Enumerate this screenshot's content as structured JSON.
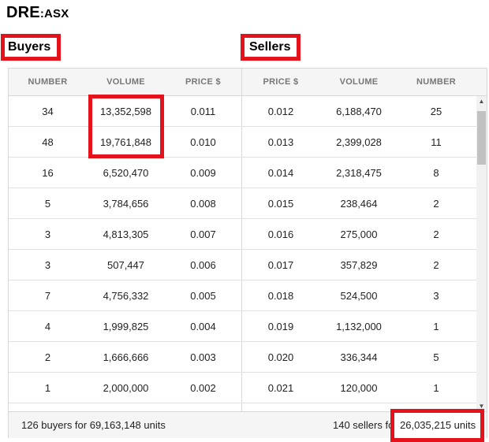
{
  "ticker": {
    "code": "DRE",
    "exchange": ":ASX"
  },
  "labels": {
    "buyers": "Buyers",
    "sellers": "Sellers"
  },
  "headers": {
    "buyer_number": "NUMBER",
    "buyer_volume": "VOLUME",
    "buyer_price": "PRICE $",
    "seller_price": "PRICE $",
    "seller_volume": "VOLUME",
    "seller_number": "NUMBER"
  },
  "rows": [
    {
      "buyer_number": "34",
      "buyer_volume": "13,352,598",
      "buyer_price": "0.011",
      "seller_price": "0.012",
      "seller_volume": "6,188,470",
      "seller_number": "25"
    },
    {
      "buyer_number": "48",
      "buyer_volume": "19,761,848",
      "buyer_price": "0.010",
      "seller_price": "0.013",
      "seller_volume": "2,399,028",
      "seller_number": "11"
    },
    {
      "buyer_number": "16",
      "buyer_volume": "6,520,470",
      "buyer_price": "0.009",
      "seller_price": "0.014",
      "seller_volume": "2,318,475",
      "seller_number": "8"
    },
    {
      "buyer_number": "5",
      "buyer_volume": "3,784,656",
      "buyer_price": "0.008",
      "seller_price": "0.015",
      "seller_volume": "238,464",
      "seller_number": "2"
    },
    {
      "buyer_number": "3",
      "buyer_volume": "4,813,305",
      "buyer_price": "0.007",
      "seller_price": "0.016",
      "seller_volume": "275,000",
      "seller_number": "2"
    },
    {
      "buyer_number": "3",
      "buyer_volume": "507,447",
      "buyer_price": "0.006",
      "seller_price": "0.017",
      "seller_volume": "357,829",
      "seller_number": "2"
    },
    {
      "buyer_number": "7",
      "buyer_volume": "4,756,332",
      "buyer_price": "0.005",
      "seller_price": "0.018",
      "seller_volume": "524,500",
      "seller_number": "3"
    },
    {
      "buyer_number": "4",
      "buyer_volume": "1,999,825",
      "buyer_price": "0.004",
      "seller_price": "0.019",
      "seller_volume": "1,132,000",
      "seller_number": "1"
    },
    {
      "buyer_number": "2",
      "buyer_volume": "1,666,666",
      "buyer_price": "0.003",
      "seller_price": "0.020",
      "seller_volume": "336,344",
      "seller_number": "5"
    },
    {
      "buyer_number": "1",
      "buyer_volume": "2,000,000",
      "buyer_price": "0.002",
      "seller_price": "0.021",
      "seller_volume": "120,000",
      "seller_number": "1"
    }
  ],
  "footer": {
    "buyers_summary": "126 buyers for 69,163,148 units",
    "sellers_summary": "140 sellers for 26,035,215 units"
  },
  "colors": {
    "highlight": "#e3121b",
    "header_bg": "#f5f5f5",
    "border": "#d8d8d8"
  }
}
